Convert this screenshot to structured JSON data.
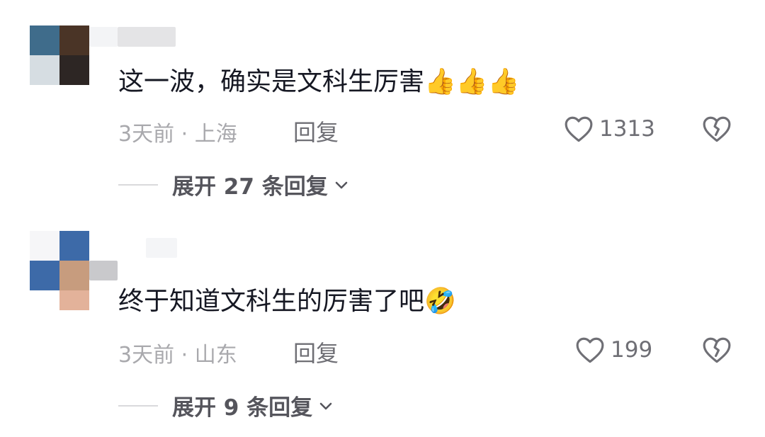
{
  "comments": [
    {
      "text": "这一波，确实是文科生厉害",
      "emoji": "👍👍👍",
      "time": "3天前",
      "separator": " · ",
      "location": "上海",
      "reply_label": "回复",
      "likes": "1313",
      "expand_label": "展开 27 条回复"
    },
    {
      "text": "终于知道文科生的厉害了吧",
      "emoji": "🤣",
      "time": "3天前",
      "separator": " · ",
      "location": "山东",
      "reply_label": "回复",
      "likes": "199",
      "expand_label": "展开 9 条回复"
    }
  ],
  "icons": {
    "like": "heart-outline-icon",
    "dislike": "broken-heart-icon",
    "expand": "chevron-down-icon"
  },
  "colors": {
    "text": "#161823",
    "meta": "#a9a9ad",
    "action": "#6f6f75",
    "thumb": "#f2b92c"
  }
}
